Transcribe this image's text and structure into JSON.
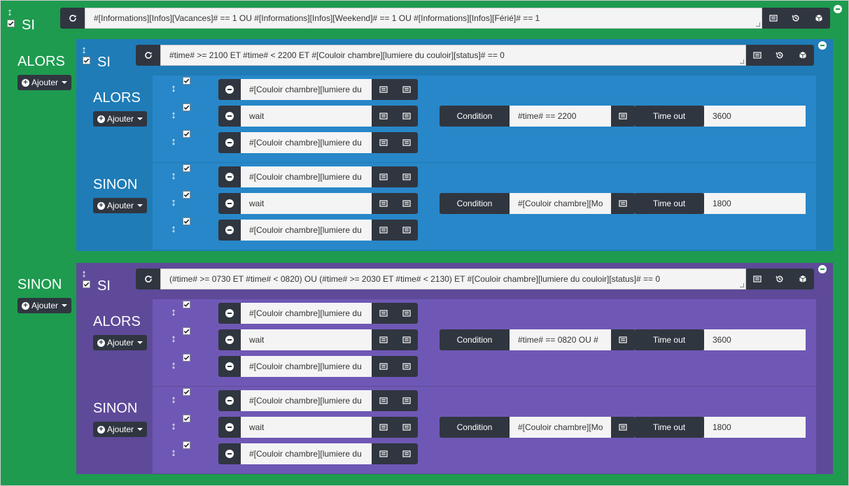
{
  "outer": {
    "si": "SI",
    "condition": "#[Informations][Infos][Vacances]# == 1   OU  #[Informations][Infos][Weekend]# == 1  OU #[Informations][Infos][Férié]# == 1",
    "alors": "ALORS",
    "sinon": "SINON",
    "ajouter": "Ajouter"
  },
  "block1": {
    "si": "SI",
    "condition": "#time# >= 2100 ET #time# < 2200 ET #[Couloir chambre][lumiere du couloir][status]# == 0",
    "alors": "ALORS",
    "sinon": "SINON",
    "ajouter": "Ajouter",
    "alors_rows": [
      {
        "text": "#[Couloir chambre][lumiere du"
      },
      {
        "text": "wait",
        "condition_label": "Condition",
        "condition_value": "#time# == 2200",
        "timeout_label": "Time out",
        "timeout_value": "3600"
      },
      {
        "text": "#[Couloir chambre][lumiere du"
      }
    ],
    "sinon_rows": [
      {
        "text": "#[Couloir chambre][lumiere du"
      },
      {
        "text": "wait",
        "condition_label": "Condition",
        "condition_value": "#[Couloir chambre][Mo",
        "timeout_label": "Time out",
        "timeout_value": "1800"
      },
      {
        "text": "#[Couloir chambre][lumiere du"
      }
    ]
  },
  "block2": {
    "si": "SI",
    "condition": "(#time# >= 0730 ET #time# < 0820) OU (#time# >= 2030 ET #time# < 2130) ET #[Couloir chambre][lumiere du couloir][status]# == 0",
    "alors": "ALORS",
    "sinon": "SINON",
    "ajouter": "Ajouter",
    "alors_rows": [
      {
        "text": "#[Couloir chambre][lumiere du"
      },
      {
        "text": "wait",
        "condition_label": "Condition",
        "condition_value": "#time# == 0820 OU  #",
        "timeout_label": "Time out",
        "timeout_value": "3600"
      },
      {
        "text": "#[Couloir chambre][lumiere du"
      }
    ],
    "sinon_rows": [
      {
        "text": "#[Couloir chambre][lumiere du"
      },
      {
        "text": "wait",
        "condition_label": "Condition",
        "condition_value": "#[Couloir chambre][Mo",
        "timeout_label": "Time out",
        "timeout_value": "1800"
      },
      {
        "text": "#[Couloir chambre][lumiere du"
      }
    ]
  },
  "colors": {
    "green": "#1e9b4f",
    "blue": "#1f7cb7",
    "blue_inner": "#2887c8",
    "purple": "#5e4a99",
    "purple_inner": "#6f58b5",
    "dark_button": "#303640"
  },
  "icons": [
    "sort-icon",
    "checkbox-icon",
    "refresh-icon",
    "list-icon",
    "history-icon",
    "cube-icon",
    "minus-icon",
    "plus-circle-icon",
    "caret-down-icon",
    "remove-icon"
  ]
}
